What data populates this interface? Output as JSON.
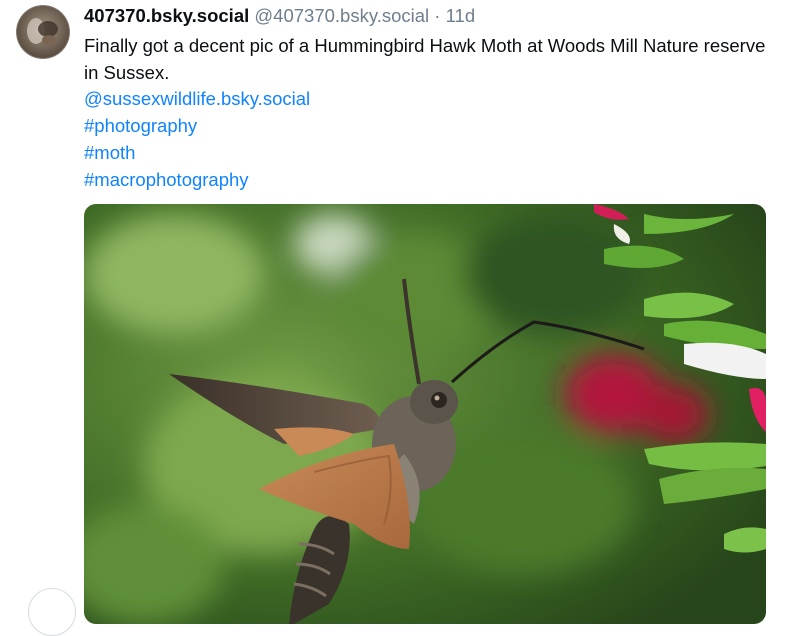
{
  "post": {
    "display_handle": "407370.bsky.social",
    "sub_handle": "@407370.bsky.social",
    "separator": " · ",
    "age": "11d",
    "text": "Finally got a decent pic of a Hummingbird Hawk Moth at Woods Mill Nature reserve in Sussex.",
    "mention": "@sussexwildlife.bsky.social",
    "hashtags": [
      "#photography",
      "#moth",
      "#macrophotography"
    ],
    "image_alt": "Hummingbird Hawk Moth feeding from a flower",
    "avatar_alt": "407370 avatar"
  },
  "colors": {
    "link": "#1083fe",
    "muted": "#6f7e8e",
    "text": "#0b0f14"
  }
}
